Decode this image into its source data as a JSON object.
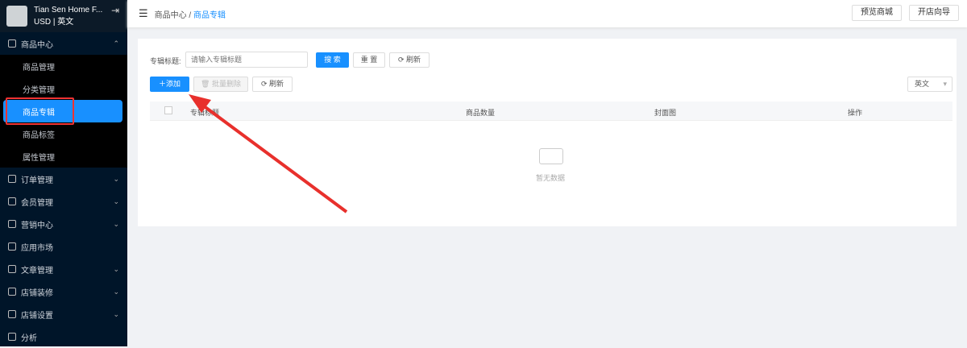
{
  "sidebar": {
    "store_name": "Tian Sen Home F...",
    "store_sub": "USD | 英文",
    "group": "商品中心",
    "sub_items": [
      "商品管理",
      "分类管理",
      "商品专辑",
      "商品标签",
      "属性管理"
    ],
    "items": [
      "订单管理",
      "会员管理",
      "营销中心",
      "应用市场",
      "文章管理",
      "店铺装修",
      "店铺设置",
      "分析"
    ]
  },
  "header": {
    "crumb_parent": "商品中心 /",
    "crumb_current": "商品专辑",
    "preview": "预览商城",
    "guide": "开店向导"
  },
  "filter": {
    "label": "专辑标题:",
    "placeholder": "请输入专辑标题",
    "search": "搜 索",
    "reset": "重 置",
    "refresh": "刷新"
  },
  "toolbar": {
    "add": "添加",
    "batch_delete": "批量删除",
    "refresh": "刷新",
    "language": "英文"
  },
  "table": {
    "columns": [
      "专辑标题",
      "商品数量",
      "封面图",
      "操作"
    ],
    "empty": "暂无数据"
  }
}
